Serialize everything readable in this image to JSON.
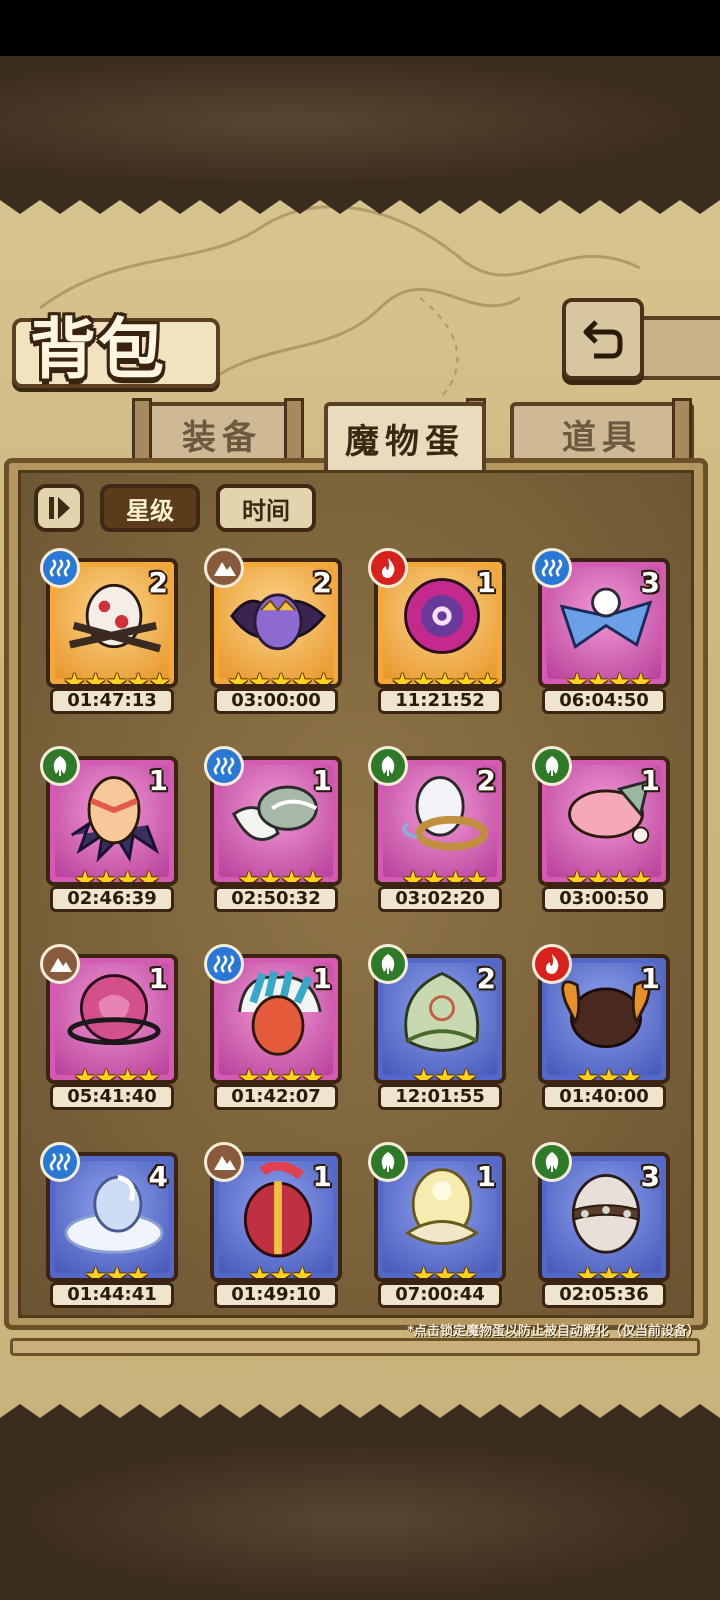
{
  "header": {
    "title": "背包"
  },
  "tabs": [
    {
      "label": "装备",
      "active": false
    },
    {
      "label": "魔物蛋",
      "active": true
    },
    {
      "label": "道具",
      "active": false
    }
  ],
  "filters": [
    {
      "label": "星级",
      "active": true
    },
    {
      "label": "时间",
      "active": false
    }
  ],
  "eggs": [
    {
      "count": "2",
      "element": "water",
      "frame": "gold",
      "stars": "★★★★★",
      "timer": "01:47:13",
      "art": "red-spotted-egg"
    },
    {
      "count": "2",
      "element": "earth",
      "frame": "gold",
      "stars": "★★★★★",
      "timer": "03:00:00",
      "art": "purple-butterfly-egg"
    },
    {
      "count": "1",
      "element": "fire",
      "frame": "gold",
      "stars": "★★★★★",
      "timer": "11:21:52",
      "art": "pink-orb-egg"
    },
    {
      "count": "3",
      "element": "water",
      "frame": "pink",
      "stars": "★★★★",
      "timer": "06:04:50",
      "art": "blue-ribbon-egg"
    },
    {
      "count": "1",
      "element": "wood",
      "frame": "pink",
      "stars": "★★★★",
      "timer": "02:46:39",
      "art": "feathered-egg"
    },
    {
      "count": "1",
      "element": "water",
      "frame": "pink",
      "stars": "★★★★",
      "timer": "02:50:32",
      "art": "wing-egg"
    },
    {
      "count": "2",
      "element": "wood",
      "frame": "pink",
      "stars": "★★★★",
      "timer": "03:02:20",
      "art": "ring-egg"
    },
    {
      "count": "1",
      "element": "wood",
      "frame": "pink",
      "stars": "★★★★",
      "timer": "03:00:50",
      "art": "pink-bunny-egg"
    },
    {
      "count": "1",
      "element": "earth",
      "frame": "pink",
      "stars": "★★★★",
      "timer": "05:41:40",
      "art": "thorn-egg"
    },
    {
      "count": "1",
      "element": "water",
      "frame": "pink",
      "stars": "★★★★",
      "timer": "01:42:07",
      "art": "feather-headdress-egg"
    },
    {
      "count": "2",
      "element": "wood",
      "frame": "blue",
      "stars": "★★★",
      "timer": "12:01:55",
      "art": "leaf-egg"
    },
    {
      "count": "1",
      "element": "fire",
      "frame": "blue",
      "stars": "★★★",
      "timer": "01:40:00",
      "art": "horned-fur-egg"
    },
    {
      "count": "4",
      "element": "water",
      "frame": "blue",
      "stars": "★★★",
      "timer": "01:44:41",
      "art": "cloud-egg"
    },
    {
      "count": "1",
      "element": "earth",
      "frame": "blue",
      "stars": "★★★",
      "timer": "01:49:10",
      "art": "helmet-egg"
    },
    {
      "count": "1",
      "element": "wood",
      "frame": "blue",
      "stars": "★★★",
      "timer": "07:00:44",
      "art": "flower-egg"
    },
    {
      "count": "3",
      "element": "wood",
      "frame": "blue",
      "stars": "★★★",
      "timer": "02:05:36",
      "art": "spiked-collar-egg"
    }
  ],
  "element_colors": {
    "water": "#2a78d6",
    "earth": "#8a5a3c",
    "fire": "#d8201c",
    "wood": "#2f7a28"
  },
  "footnote": "*点击锁定魔物蛋以防止被自动孵化（仅当前设备）"
}
